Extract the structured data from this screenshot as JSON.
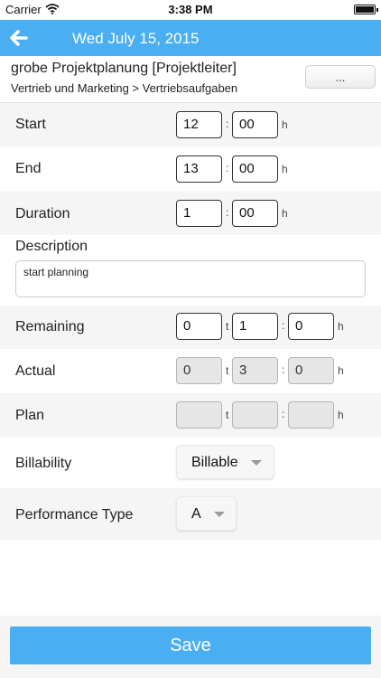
{
  "status_bar": {
    "carrier": "Carrier",
    "time": "3:38 PM"
  },
  "nav": {
    "title": "Wed July 15, 2015"
  },
  "header": {
    "project": "grobe Projektplanung [Projektleiter]",
    "path": "Vertrieb und Marketing > Vertriebsaufgaben",
    "more_label": "..."
  },
  "form": {
    "start": {
      "label": "Start",
      "hours": "12",
      "minutes": "00",
      "unit": "h"
    },
    "end": {
      "label": "End",
      "hours": "13",
      "minutes": "00",
      "unit": "h"
    },
    "duration": {
      "label": "Duration",
      "hours": "1",
      "minutes": "00",
      "unit": "h"
    },
    "description": {
      "label": "Description",
      "value": "start planning"
    },
    "remaining": {
      "label": "Remaining",
      "days": "0",
      "hours": "1",
      "minutes": "0",
      "day_unit": "t",
      "unit": "h"
    },
    "actual": {
      "label": "Actual",
      "days": "0",
      "hours": "3",
      "minutes": "0",
      "day_unit": "t",
      "unit": "h"
    },
    "plan": {
      "label": "Plan",
      "days": "",
      "hours": "",
      "minutes": "",
      "day_unit": "t",
      "unit": "h"
    },
    "billability": {
      "label": "Billability",
      "value": "Billable"
    },
    "performance_type": {
      "label": "Performance Type",
      "value": "A"
    }
  },
  "save_label": "Save",
  "colors": {
    "accent": "#4aaef2",
    "row_gray": "#f5f5f5"
  }
}
